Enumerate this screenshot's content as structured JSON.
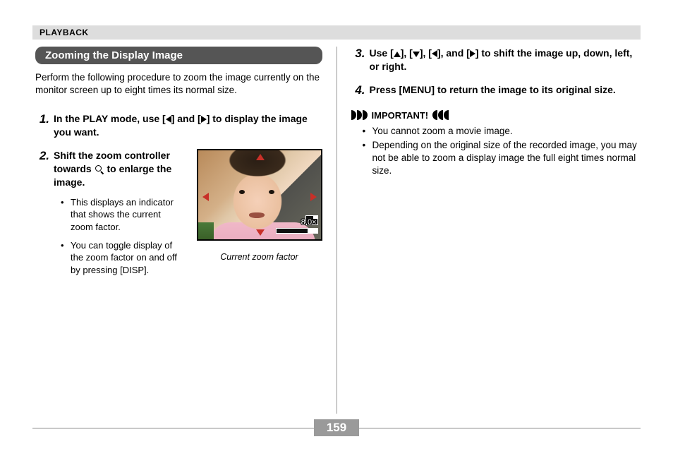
{
  "header": "PLAYBACK",
  "section_title": "Zooming the Display Image",
  "intro": "Perform the following procedure to zoom the image currently on the monitor screen up to eight times its normal size.",
  "step1_num": "1.",
  "step1_a": "In the PLAY mode, use [",
  "step1_b": "] and [",
  "step1_c": "] to display the image you want.",
  "step2_num": "2.",
  "step2_a": "Shift the zoom controller towards ",
  "step2_b": " to enlarge the image.",
  "step2_bullet1": "This displays an indicator that shows the current zoom factor.",
  "step2_bullet2": "You can toggle display of the zoom factor on and off by pressing [DISP].",
  "zoom_value": "8.0×",
  "caption": "Current zoom factor",
  "step3_num": "3.",
  "step3_a": "Use [",
  "step3_b": "], [",
  "step3_c": "], [",
  "step3_d": "], and [",
  "step3_e": "] to shift the image up, down, left, or right.",
  "step4_num": "4.",
  "step4": "Press [MENU] to return the image to its original size.",
  "important_label": "IMPORTANT!",
  "imp1": "You cannot zoom a movie image.",
  "imp2": "Depending on the original size of the recorded image, you may not be able to zoom a display image the full eight times normal size.",
  "page": "159"
}
